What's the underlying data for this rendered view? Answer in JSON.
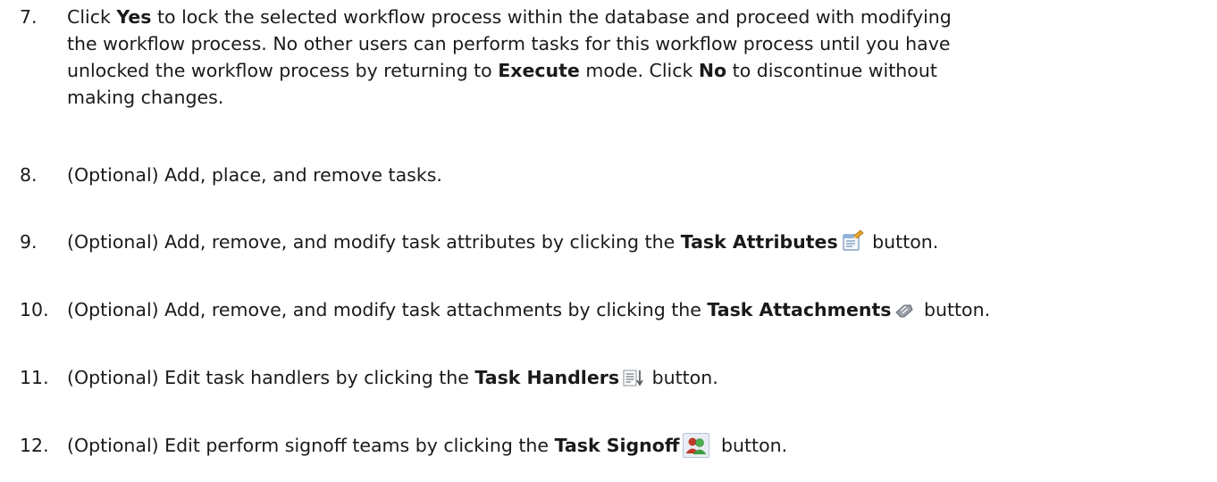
{
  "steps": [
    {
      "number": "7.",
      "parts": [
        "Click ",
        "Yes",
        " to lock the selected workflow process within the database and proceed with modifying the workflow process. No other users can perform tasks for this workflow process until you have unlocked the workflow process by returning to ",
        "Execute",
        " mode. Click ",
        "No",
        " to discontinue without making changes."
      ]
    },
    {
      "number": "8.",
      "text": "(Optional) Add, place, and remove tasks."
    },
    {
      "number": "9.",
      "before": "(Optional) Add, remove, and modify task attributes by clicking the ",
      "bold": "Task Attributes",
      "icon": "task-attributes-icon",
      "after": " button."
    },
    {
      "number": "10.",
      "before": "(Optional) Add, remove, and modify task attachments by clicking the ",
      "bold": "Task Attachments",
      "icon": "task-attachments-icon",
      "after": " button."
    },
    {
      "number": "11.",
      "before": "(Optional) Edit task handlers by clicking the ",
      "bold": "Task Handlers",
      "icon": "task-handlers-icon",
      "after": " button."
    },
    {
      "number": "12.",
      "before": "(Optional) Edit perform signoff teams by clicking the ",
      "bold": "Task Signoff",
      "icon": "task-signoff-icon",
      "after": " button."
    }
  ]
}
